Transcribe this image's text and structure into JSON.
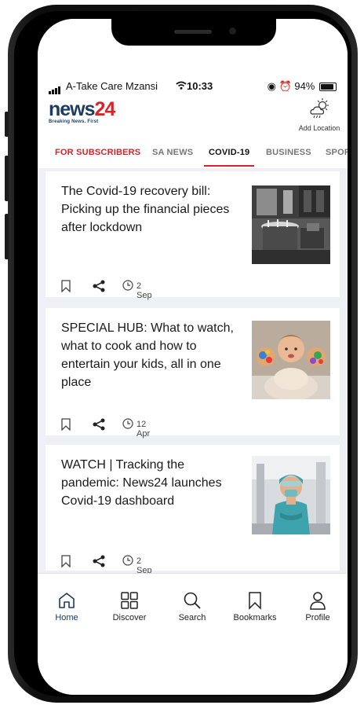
{
  "status": {
    "carrier": "A-Take Care Mzansi",
    "time": "10:33",
    "battery": "94%"
  },
  "brand": {
    "name_part1": "news",
    "name_part2": "24",
    "tagline": "Breaking News. First"
  },
  "location": {
    "label": "Add Location"
  },
  "tabs": [
    {
      "label": "FOR SUBSCRIBERS"
    },
    {
      "label": "SA NEWS"
    },
    {
      "label": "COVID-19"
    },
    {
      "label": "BUSINESS"
    },
    {
      "label": "SPORT"
    }
  ],
  "active_tab": "COVID-19",
  "articles": [
    {
      "title": "The Covid-19 recovery bill: Picking up the financial pieces after lockdown",
      "date": "2 Sep"
    },
    {
      "title": "SPECIAL HUB: What to watch, what to cook and how to entertain your kids, all in one place",
      "date": "12 Apr"
    },
    {
      "title": "WATCH | Tracking the pandemic: News24 launches Covid-19 dashboard",
      "date": "2 Sep"
    }
  ],
  "nav": [
    {
      "label": "Home",
      "icon": "home-icon"
    },
    {
      "label": "Discover",
      "icon": "grid-icon"
    },
    {
      "label": "Search",
      "icon": "search-icon"
    },
    {
      "label": "Bookmarks",
      "icon": "bookmark-icon"
    },
    {
      "label": "Profile",
      "icon": "profile-icon"
    }
  ],
  "colors": {
    "brand_navy": "#1f3a63",
    "brand_red": "#d8232a"
  }
}
